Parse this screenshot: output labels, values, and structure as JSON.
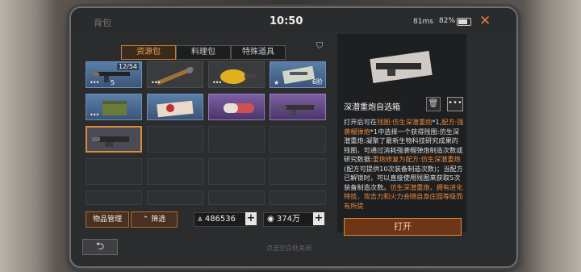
{
  "window": {
    "title": "背包",
    "close_icon": "close-icon"
  },
  "status": {
    "time": "10:50",
    "ping": "81ms",
    "battery": "82%",
    "battery_level": 0.82
  },
  "tabs": [
    {
      "label": "资源包",
      "active": true
    },
    {
      "label": "料理包",
      "active": false
    },
    {
      "label": "特殊道具",
      "active": false
    }
  ],
  "inventory": {
    "items": [
      {
        "rarity": "blue",
        "count": "12/54",
        "number": "5",
        "icon": "rifle-icon"
      },
      {
        "rarity": "gray",
        "icon": "spiked-bat-icon"
      },
      {
        "rarity": "gray",
        "icon": "yellow-drill-icon"
      },
      {
        "rarity": "blue",
        "level": "6阶",
        "icon": "blueprint-icon"
      },
      {
        "rarity": "blue",
        "icon": "ammo-crate-icon"
      },
      {
        "rarity": "blue",
        "icon": "voucher-icon"
      },
      {
        "rarity": "purple",
        "icon": "capsule-icon"
      },
      {
        "rarity": "purple",
        "icon": "machine-gun-icon"
      },
      {
        "rarity": "purple",
        "icon": "heavy-cannon-icon",
        "selected": true
      }
    ]
  },
  "footer": {
    "manage_label": "物品管理",
    "filter_label": "筛选",
    "resource1": "486536",
    "resource2": "374万",
    "hint": "点击空白处关闭"
  },
  "detail": {
    "name": "深潜重炮自选箱",
    "desc": [
      {
        "t": "打开后可在",
        "c": "w"
      },
      {
        "t": "残图:仿生深潜重炮",
        "c": "o"
      },
      {
        "t": "*1,",
        "c": "w"
      },
      {
        "t": "配方:强袭榴弹炮",
        "c": "o"
      },
      {
        "t": "*1中选择一个获得",
        "c": "w"
      },
      {
        "t": "残图:仿生深潜重炮:",
        "c": "w"
      },
      {
        "t": "凝聚了最新生物科技研究成果的残图，可通过消耗强袭榴弹炮制造次数或研究数据:",
        "c": "w"
      },
      {
        "t": "重炮修复为",
        "c": "o"
      },
      {
        "t": "配方:仿生深潜重炮",
        "c": "o"
      },
      {
        "t": "(配方可提供10次装备制造次数)；当配方已解锁时，可以直接使用残图来获取5次装备制造次数。",
        "c": "w"
      },
      {
        "t": "仿生深潜重炮，拥有进化特技，攻击力和火力会随自身庄园等级而有所提",
        "c": "o"
      }
    ],
    "open_label": "打开"
  }
}
